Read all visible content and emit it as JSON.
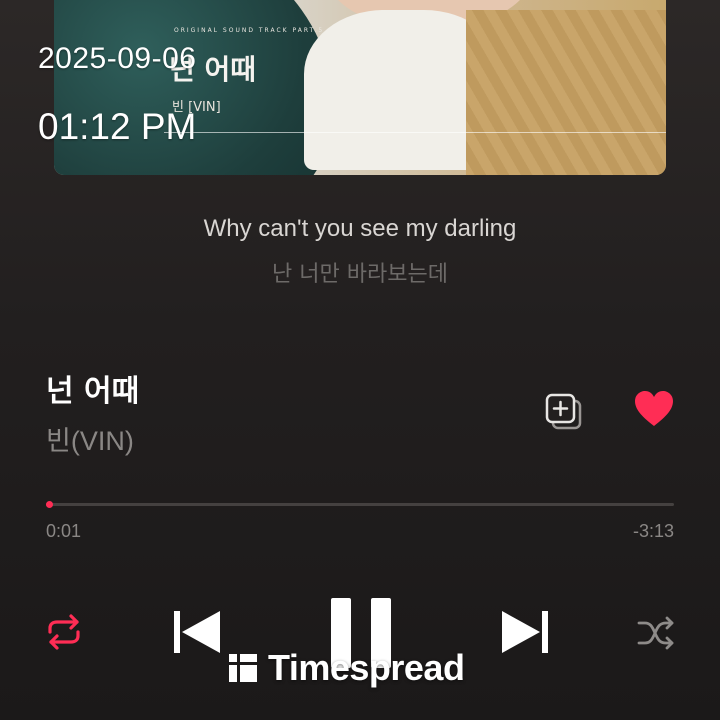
{
  "timestamp": {
    "date": "2025-09-06",
    "time": "01:12 PM"
  },
  "album_art": {
    "ost_line": "ORIGINAL SOUND TRACK PART.5",
    "title": "넌 어때",
    "artist": "빈 [VIN]"
  },
  "lyrics": {
    "current": "Why can't you see my darling",
    "next": "난 너만 바라보는데"
  },
  "track": {
    "title": "넌 어때",
    "artist": "빈(VIN)",
    "liked": true
  },
  "playback": {
    "elapsed": "0:01",
    "remaining": "-3:13",
    "progress_fraction": 0.005,
    "is_playing": true,
    "repeat_active": true
  },
  "icons": {
    "add": "add-to-playlist-icon",
    "like": "heart-icon",
    "repeat": "repeat-icon",
    "previous": "skip-previous-icon",
    "pause": "pause-icon",
    "next": "skip-next-icon",
    "shuffle": "shuffle-icon",
    "watermark": "timespread-logo-icon"
  },
  "colors": {
    "accent": "#ff2d55",
    "background": "#221f1f",
    "lyric_current": "#d9d6d3",
    "lyric_next": "#6d6a68",
    "secondary_text": "#8a8785"
  },
  "watermark": {
    "text": "Timespread"
  }
}
